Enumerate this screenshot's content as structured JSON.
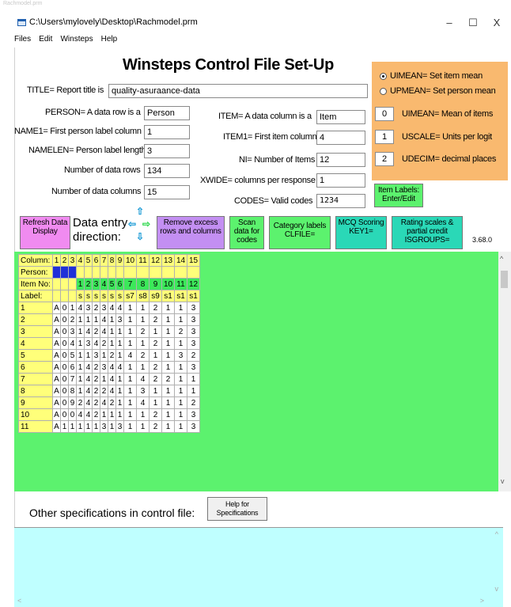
{
  "window": {
    "top_strip": "Rachmodel.prm",
    "title": "C:\\Users\\mylovely\\Desktop\\Rachmodel.prm",
    "min": "–",
    "max": "☐",
    "close": "X"
  },
  "menu": [
    "Files",
    "Edit",
    "Winsteps",
    "Help"
  ],
  "header": {
    "title": "Winsteps Control File Set-Up"
  },
  "form": {
    "title_label": "TITLE= Report title is",
    "title_value": "quality-asuraance-data",
    "person_label": "PERSON= A data row is a",
    "person_value": "Person",
    "name1_label": "NAME1= First person label column",
    "name1_value": "1",
    "namelen_label": "NAMELEN= Person label length",
    "namelen_value": "3",
    "datarows_label": "Number of data rows",
    "datarows_value": "134",
    "datacols_label": "Number of data columns",
    "datacols_value": "15",
    "item_label": "ITEM= A data column is a",
    "item_value": "Item",
    "item1_label": "ITEM1= First item column",
    "item1_value": "4",
    "ni_label": "NI= Number of Items",
    "ni_value": "12",
    "xwide_label": "XWIDE= columns per response",
    "xwide_value": "1",
    "codes_label": "CODES= Valid codes",
    "codes_value": "1234"
  },
  "right_panel": {
    "uimean_set": "UIMEAN= Set item mean",
    "upmean_set": "UPMEAN= Set person mean",
    "uimean_value": "0",
    "uimean_label": "UIMEAN= Mean of items",
    "uscale_value": "1",
    "uscale_label": "USCALE= Units per logit",
    "udecim_value": "2",
    "udecim_label": "UDECIM= decimal places",
    "item_labels_btn": "Item Labels: Enter/Edit"
  },
  "toolbar": {
    "refresh": "Refresh Data Display",
    "data_entry": "Data entry direction:",
    "remove": "Remove excess rows and columns",
    "scan": "Scan data for codes",
    "category": "Category labels CLFILE=",
    "mcq": "MCQ Scoring KEY1=",
    "rating": "Rating scales & partial credit ISGROUPS=",
    "version": "3.68.0"
  },
  "grid": {
    "row_labels": [
      "Column:",
      "Person:",
      "Item No:",
      "Label:"
    ],
    "columns": [
      "1",
      "2",
      "3",
      "4",
      "5",
      "6",
      "7",
      "8",
      "9",
      "10",
      "11",
      "12",
      "13",
      "14",
      "15"
    ],
    "item_nos": [
      "",
      "",
      "",
      "1",
      "2",
      "3",
      "4",
      "5",
      "6",
      "7",
      "8",
      "9",
      "10",
      "11",
      "12"
    ],
    "labels": [
      "",
      "",
      "",
      "s",
      "s",
      "s",
      "s",
      "s",
      "s",
      "s7",
      "s8",
      "s9",
      "s1",
      "s1",
      "s1"
    ],
    "rows": [
      {
        "n": "1",
        "cells": [
          "A",
          "0",
          "1",
          "4",
          "3",
          "2",
          "3",
          "4",
          "4",
          "1",
          "1",
          "2",
          "1",
          "1",
          "3"
        ]
      },
      {
        "n": "2",
        "cells": [
          "A",
          "0",
          "2",
          "1",
          "1",
          "1",
          "4",
          "1",
          "3",
          "1",
          "1",
          "2",
          "1",
          "1",
          "3"
        ]
      },
      {
        "n": "3",
        "cells": [
          "A",
          "0",
          "3",
          "1",
          "4",
          "2",
          "4",
          "1",
          "1",
          "1",
          "2",
          "1",
          "1",
          "2",
          "3"
        ]
      },
      {
        "n": "4",
        "cells": [
          "A",
          "0",
          "4",
          "1",
          "3",
          "4",
          "2",
          "1",
          "1",
          "1",
          "1",
          "2",
          "1",
          "1",
          "3"
        ]
      },
      {
        "n": "5",
        "cells": [
          "A",
          "0",
          "5",
          "1",
          "1",
          "3",
          "1",
          "2",
          "1",
          "4",
          "2",
          "1",
          "1",
          "3",
          "2"
        ]
      },
      {
        "n": "6",
        "cells": [
          "A",
          "0",
          "6",
          "1",
          "4",
          "2",
          "3",
          "4",
          "4",
          "1",
          "1",
          "2",
          "1",
          "1",
          "3"
        ]
      },
      {
        "n": "7",
        "cells": [
          "A",
          "0",
          "7",
          "1",
          "4",
          "2",
          "1",
          "4",
          "1",
          "1",
          "4",
          "2",
          "2",
          "1",
          "1"
        ]
      },
      {
        "n": "8",
        "cells": [
          "A",
          "0",
          "8",
          "1",
          "4",
          "2",
          "2",
          "4",
          "1",
          "1",
          "3",
          "1",
          "1",
          "1",
          "1"
        ]
      },
      {
        "n": "9",
        "cells": [
          "A",
          "0",
          "9",
          "2",
          "4",
          "2",
          "4",
          "2",
          "1",
          "1",
          "4",
          "1",
          "1",
          "1",
          "2"
        ]
      },
      {
        "n": "10",
        "cells": [
          "A",
          "0",
          "0",
          "4",
          "4",
          "2",
          "1",
          "1",
          "1",
          "1",
          "1",
          "2",
          "1",
          "1",
          "3"
        ]
      },
      {
        "n": "11",
        "cells": [
          "A",
          "1",
          "1",
          "1",
          "1",
          "1",
          "3",
          "1",
          "3",
          "1",
          "1",
          "2",
          "1",
          "1",
          "3"
        ]
      }
    ]
  },
  "bottom": {
    "label": "Other specifications in control file:",
    "help_btn": "Help for Specifications"
  },
  "colors": {
    "orange_panel": "#f9b96f",
    "grid_green": "#5cf26e",
    "textarea_cyan": "#bfffff",
    "header_yellow": "#ffff7a",
    "person_blue": "#1f30d8",
    "item_green": "#3ce85a"
  }
}
